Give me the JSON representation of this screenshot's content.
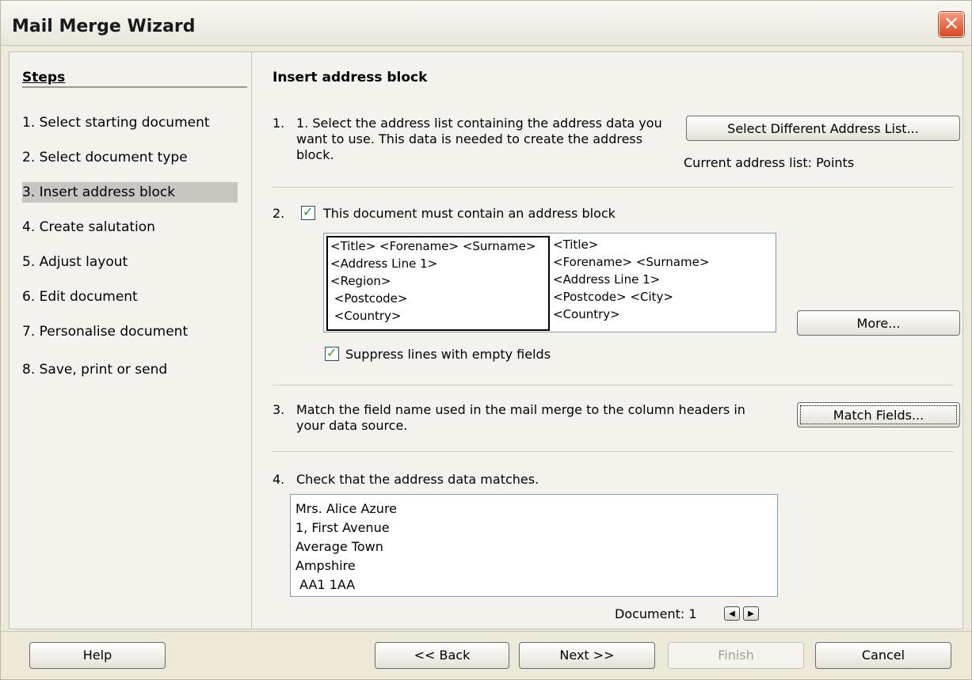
{
  "window": {
    "title": "Mail Merge Wizard",
    "close_glyph": "✕"
  },
  "steps": {
    "title": "Steps",
    "items": [
      "1.  Select starting document",
      "2.  Select document type",
      "3.  Insert address block",
      "4.  Create salutation",
      "5.  Adjust layout",
      "6.  Edit document",
      "7.  Personalise document",
      "8.  Save, print or send"
    ]
  },
  "main": {
    "heading": "Insert address block",
    "section1": {
      "number": "1.",
      "text": "1. Select the address list containing the address data you want to use. This data is needed to create the address block.",
      "button": "Select Different Address List...",
      "current_list": "Current address list: Points"
    },
    "section2": {
      "number": "2.",
      "checkbox_label": "This document must contain an address block",
      "block1": "<Title> <Forename> <Surname>\n<Address Line 1>\n<Region>\n <Postcode>\n <Country>",
      "block2": "<Title>\n<Forename> <Surname>\n<Address Line 1>\n<Postcode> <City>\n<Country>",
      "more_button": "More...",
      "suppress_label": "Suppress lines with empty fields"
    },
    "section3": {
      "number": "3.",
      "text": "Match the field name used in the mail merge to the column headers in your data source.",
      "button": "Match Fields..."
    },
    "section4": {
      "number": "4.",
      "text": "Check that the address data matches.",
      "address_lines": [
        "Mrs. Alice Azure",
        "1, First Avenue",
        "Average Town",
        "Ampshire",
        " AA1 1AA"
      ],
      "document_label": "Document: 1",
      "prev_glyph": "◀",
      "next_glyph": "▶"
    }
  },
  "footer": {
    "help": "Help",
    "back": "<< Back",
    "next": "Next >>",
    "finish": "Finish",
    "cancel": "Cancel"
  }
}
